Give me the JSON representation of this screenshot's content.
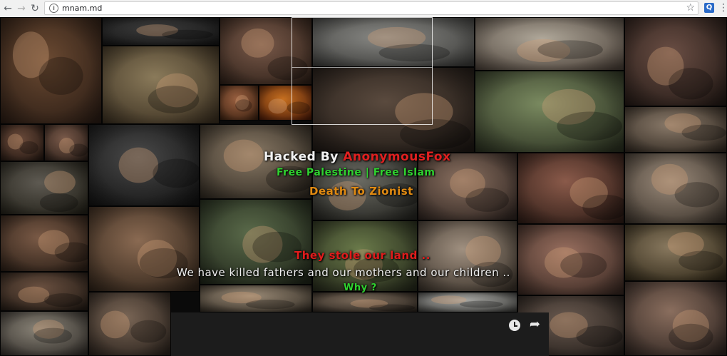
{
  "browser": {
    "url": "mnam.md",
    "back_glyph": "←",
    "forward_glyph": "→",
    "reload_glyph": "↻",
    "info_glyph": "i",
    "star_glyph": "☆",
    "ext_glyph": "Q",
    "menu_glyph": "⋮"
  },
  "overlay": {
    "hacked_prefix": "Hacked By ",
    "hacker_name": "AnonymousFox",
    "line_palestine": "Free Palestine | Free Islam",
    "line_zionist": "Death To Zionist",
    "line_stole": "They stole our land ..",
    "line_killed": "We have killed fathers and our mothers and our children ..",
    "line_why": "Why ?"
  },
  "video": {
    "share_glyph": "➦"
  },
  "colors": {
    "hacker_name": "#e02020",
    "green_text": "#2fd22f",
    "orange_text": "#e08a12",
    "red_text": "#e01c1c"
  }
}
